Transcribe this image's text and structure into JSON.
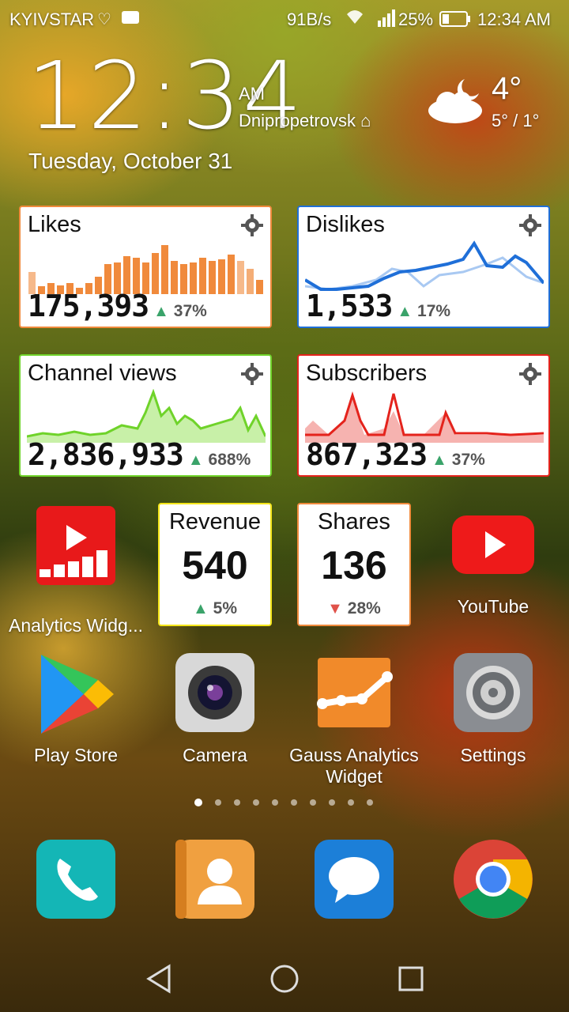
{
  "status_bar": {
    "carrier": "KYIVSTAR",
    "speed": "91B/s",
    "battery": "25%",
    "time": "12:34 AM"
  },
  "lockclock": {
    "time": "12:34",
    "ampm": "AM",
    "city": "Dnipropetrovsk",
    "date": "Tuesday, October 31",
    "temperature": "4°",
    "range": "5° / 1°"
  },
  "widgets": {
    "likes": {
      "title": "Likes",
      "value": "175,393",
      "change": "37%",
      "trend": "up",
      "color": "#f08a3c"
    },
    "dislikes": {
      "title": "Dislikes",
      "value": "1,533",
      "change": "17%",
      "trend": "up",
      "color": "#1f6fd8"
    },
    "views": {
      "title": "Channel views",
      "value": "2,836,933",
      "change": "688%",
      "trend": "up",
      "color": "#6fd32a"
    },
    "subscribers": {
      "title": "Subscribers",
      "value": "867,323",
      "change": "37%",
      "trend": "up",
      "color": "#e4231c"
    },
    "revenue": {
      "title": "Revenue",
      "value": "540",
      "change": "5%",
      "trend": "up",
      "color": "#f5e61a"
    },
    "shares": {
      "title": "Shares",
      "value": "136",
      "change": "28%",
      "trend": "down",
      "color": "#f08a3c"
    }
  },
  "apps": {
    "analytics_widget": "Analytics Widg...",
    "youtube": "YouTube",
    "play_store": "Play Store",
    "camera": "Camera",
    "gauss": "Gauss Analytics Widget",
    "settings": "Settings"
  },
  "dock": [
    "phone-icon",
    "contacts-icon",
    "messages-icon",
    "chrome-icon"
  ],
  "page_indicator": {
    "count": 10,
    "active": 1
  },
  "nav": [
    "back-button",
    "home-button",
    "recents-button"
  ]
}
